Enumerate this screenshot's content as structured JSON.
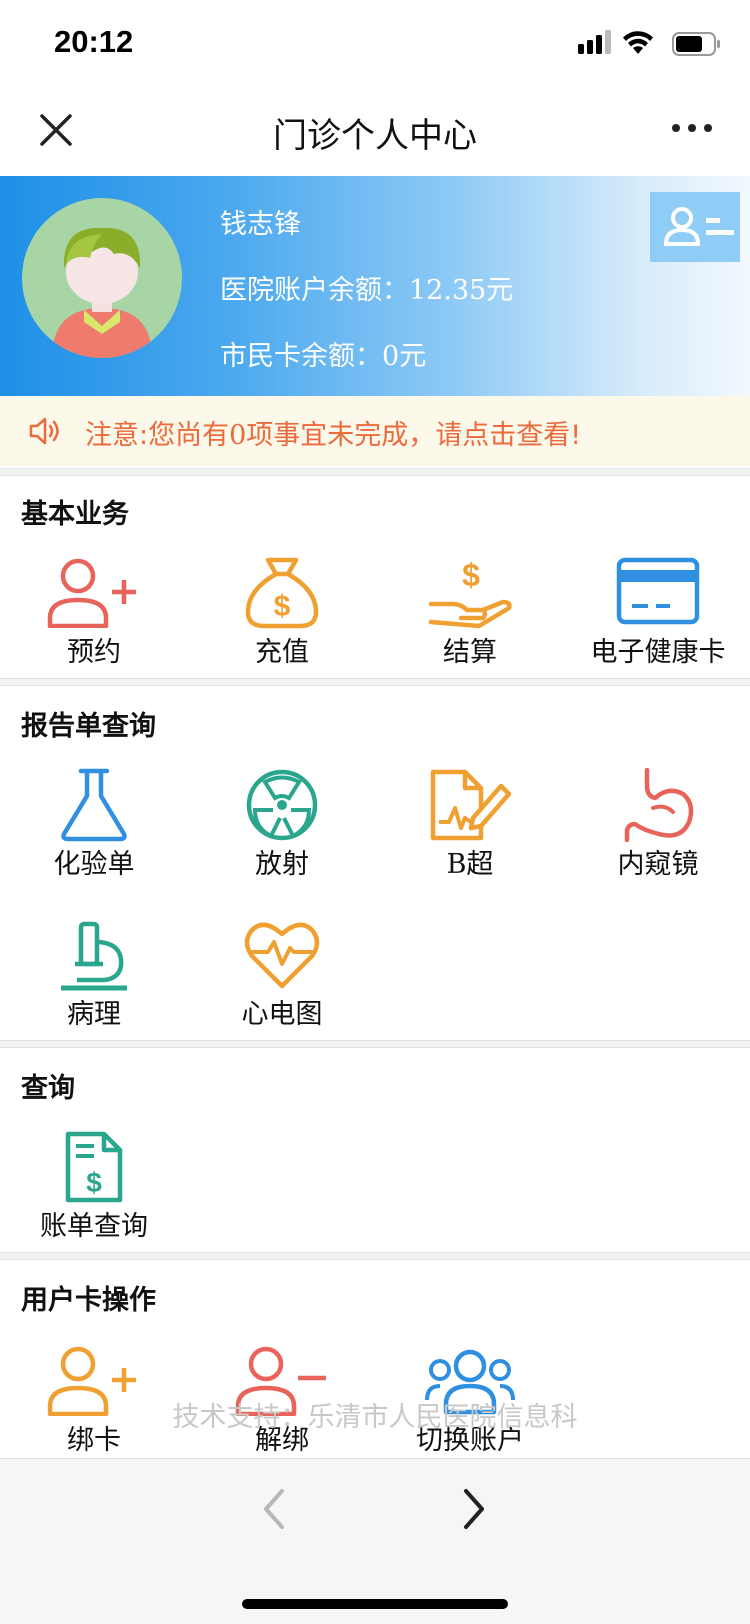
{
  "status": {
    "time": "20:12"
  },
  "nav": {
    "title": "门诊个人中心"
  },
  "profile": {
    "name": "钱志锋",
    "balance_label": "医院账户余额：",
    "balance_value": "12.35",
    "balance_unit": "元",
    "card_label": "市民卡余额：",
    "card_value": "0",
    "card_unit": "元"
  },
  "notice": {
    "text_pre": "注意:您尚有",
    "count": "0",
    "text_post": "项事宜未完成，请点击查看!"
  },
  "sections": [
    {
      "title": "基本业务",
      "items": [
        {
          "label": "预约"
        },
        {
          "label": "充值"
        },
        {
          "label": "结算"
        },
        {
          "label": "电子健康卡"
        }
      ]
    },
    {
      "title": "报告单查询",
      "items": [
        {
          "label": "化验单"
        },
        {
          "label": "放射"
        },
        {
          "label": "B超"
        },
        {
          "label": "内窥镜"
        },
        {
          "label": "病理"
        },
        {
          "label": "心电图"
        }
      ]
    },
    {
      "title": "查询",
      "items": [
        {
          "label": "账单查询"
        }
      ]
    },
    {
      "title": "用户卡操作",
      "items": [
        {
          "label": "绑卡"
        },
        {
          "label": "解绑"
        },
        {
          "label": "切换账户"
        }
      ]
    }
  ],
  "footer": {
    "credit": "技术支持：乐清市人民医院信息科"
  },
  "colors": {
    "blue": "#2f8fe0",
    "orange": "#f0a030",
    "red": "#e8645a",
    "teal": "#2aa58e",
    "notice": "#ec6a3b"
  }
}
